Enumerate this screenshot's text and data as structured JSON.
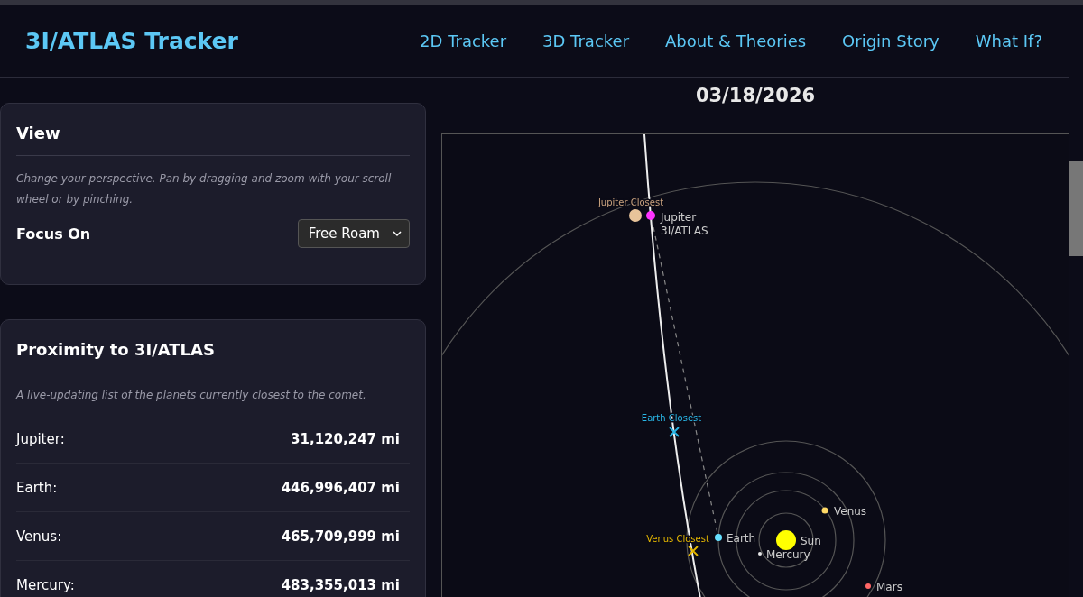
{
  "header": {
    "title": "3I/ATLAS Tracker",
    "nav": [
      "2D Tracker",
      "3D Tracker",
      "About & Theories",
      "Origin Story",
      "What If?"
    ]
  },
  "date": "03/18/2026",
  "view_card": {
    "title": "View",
    "description": "Change your perspective. Pan by dragging and zoom with your scroll wheel or by pinching.",
    "focus_label": "Focus On",
    "focus_select": {
      "value": "Free Roam"
    }
  },
  "proximity_card": {
    "title": "Proximity to 3I/ATLAS",
    "description": "A live-updating list of the planets currently closest to the comet.",
    "rows": [
      {
        "planet": "Jupiter:",
        "distance": "31,120,247 mi"
      },
      {
        "planet": "Earth:",
        "distance": "446,996,407 mi"
      },
      {
        "planet": "Venus:",
        "distance": "465,709,999 mi"
      },
      {
        "planet": "Mercury:",
        "distance": "483,355,013 mi"
      }
    ]
  },
  "map": {
    "bodies": [
      {
        "kind": "jupiter",
        "label": "Jupiter",
        "color": "#e8c49a"
      },
      {
        "kind": "comet",
        "label": "3I/ATLAS",
        "color": "#ff33ff"
      },
      {
        "kind": "venus",
        "label": "Venus",
        "color": "#ffd966"
      },
      {
        "kind": "earth",
        "label": "Earth",
        "color": "#66e0ff"
      },
      {
        "kind": "sun",
        "label": "Sun",
        "color": "#ffff00"
      },
      {
        "kind": "mercury",
        "label": "Mercury",
        "color": "#e6e6e6"
      },
      {
        "kind": "mars",
        "label": "Mars",
        "color": "#ff6666"
      }
    ],
    "closest_markers": [
      {
        "kind": "jupiter",
        "label": "Jupiter Closest",
        "color": "#c9a27e"
      },
      {
        "kind": "earth",
        "label": "Earth Closest",
        "color": "#29b6e6"
      },
      {
        "kind": "venus",
        "label": "Venus Closest",
        "color": "#e6b800"
      }
    ]
  }
}
